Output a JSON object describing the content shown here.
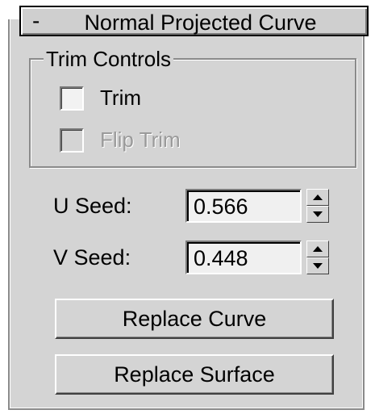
{
  "rollout": {
    "collapse_symbol": "-",
    "title": "Normal Projected Curve"
  },
  "trim_controls": {
    "group_title": "Trim Controls",
    "trim": {
      "label": "Trim",
      "checked": false,
      "enabled": true
    },
    "flip_trim": {
      "label": "Flip Trim",
      "checked": false,
      "enabled": false
    }
  },
  "seeds": {
    "u": {
      "label": "U Seed:",
      "value": "0.566"
    },
    "v": {
      "label": "V Seed:",
      "value": "0.448"
    }
  },
  "buttons": {
    "replace_curve": "Replace Curve",
    "replace_surface": "Replace Surface"
  }
}
